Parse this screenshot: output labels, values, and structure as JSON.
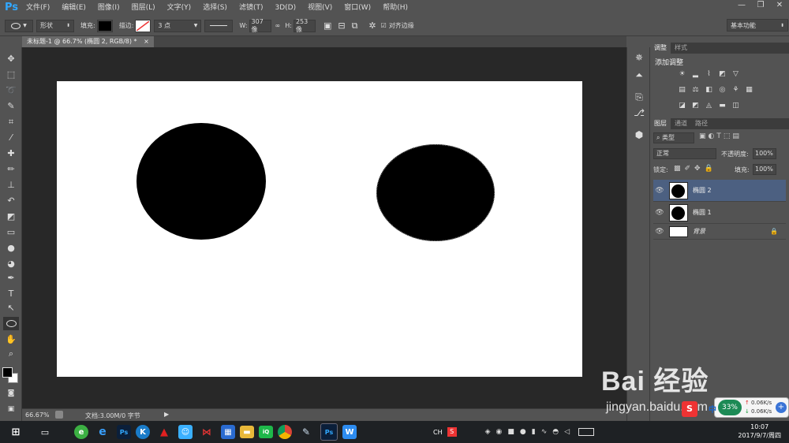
{
  "app": {
    "logo": "Ps"
  },
  "menu": [
    "文件(F)",
    "编辑(E)",
    "图像(I)",
    "图层(L)",
    "文字(Y)",
    "选择(S)",
    "滤镜(T)",
    "3D(D)",
    "视图(V)",
    "窗口(W)",
    "帮助(H)"
  ],
  "window_controls": [
    "—",
    "❐",
    "✕"
  ],
  "options": {
    "mode": "形状",
    "fill_label": "填充:",
    "stroke_label": "描边:",
    "stroke_size": "3 点",
    "w_label": "W:",
    "w_value": "307 像",
    "h_label": "H:",
    "h_value": "253 像",
    "align_edges": "对齐边缘",
    "workspace": "基本功能"
  },
  "document": {
    "tab_title": "未标题-1 @ 66.7% (椭圆 2, RGB/8) *",
    "tab_close": "×"
  },
  "status": {
    "zoom": "66.67%",
    "doc_info": "文档:3.00M/0 字节"
  },
  "adjust_panel": {
    "tabs": [
      "调整",
      "样式"
    ],
    "header": "添加调整"
  },
  "layers_panel": {
    "tabs": [
      "图层",
      "通道",
      "路径"
    ],
    "filter": "类型",
    "blend_mode": "正常",
    "opacity_label": "不透明度:",
    "opacity_value": "100%",
    "lock_label": "锁定:",
    "fill_label": "填充:",
    "fill_value": "100%",
    "layers": [
      {
        "name": "椭圆 2",
        "selected": true
      },
      {
        "name": "椭圆 1",
        "selected": false
      },
      {
        "name": "背景",
        "selected": false
      }
    ]
  },
  "taskbar": {
    "ime": "CH",
    "time": "10:07",
    "date": "2017/9/7/周四"
  },
  "net_widget": {
    "percent": "33%",
    "ime": "中",
    "up": "0.06K/s",
    "down": "0.06K/s"
  },
  "watermark": {
    "brand": "Bai 经验",
    "url": "jingyan.baidu.com"
  }
}
